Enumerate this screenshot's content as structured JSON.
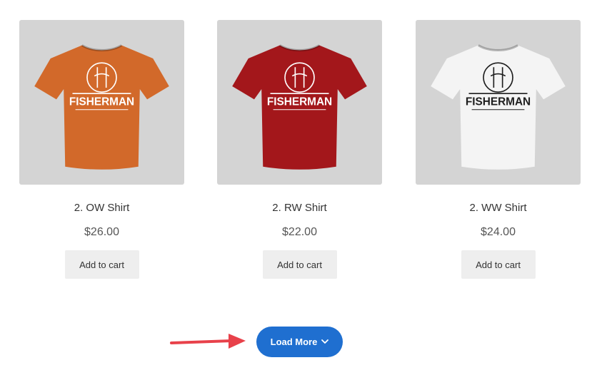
{
  "products": [
    {
      "name": "2. OW Shirt",
      "price": "$26.00",
      "button": "Add to cart",
      "color": "#d2692a",
      "ink": "#ffffff",
      "logo_text": "FISHERMAN"
    },
    {
      "name": "2. RW Shirt",
      "price": "$22.00",
      "button": "Add to cart",
      "color": "#a3171b",
      "ink": "#ffffff",
      "logo_text": "FISHERMAN"
    },
    {
      "name": "2. WW Shirt",
      "price": "$24.00",
      "button": "Add to cart",
      "color": "#f4f4f4",
      "ink": "#1e1e1e",
      "logo_text": "FISHERMAN"
    }
  ],
  "load_more": {
    "label": "Load More",
    "icon": "chevron-down-icon",
    "color": "#1f6fd0"
  },
  "annotation": {
    "icon": "arrow-right-icon",
    "color": "#e8414a"
  }
}
